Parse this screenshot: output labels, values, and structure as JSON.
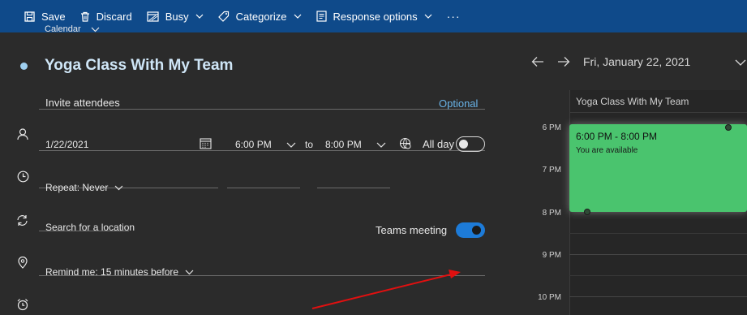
{
  "toolbar": {
    "save": "Save",
    "discard": "Discard",
    "busy": "Busy",
    "categorize": "Categorize",
    "response": "Response options",
    "more": "···"
  },
  "form": {
    "calendar_label": "Calendar",
    "title": "Yoga Class With My Team",
    "attendees_placeholder": "Invite attendees",
    "optional": "Optional",
    "date": "1/22/2021",
    "start_time": "6:00 PM",
    "to": "to",
    "end_time": "8:00 PM",
    "all_day": "All day",
    "all_day_on": false,
    "repeat": "Repeat: Never",
    "location_placeholder": "Search for a location",
    "teams_meeting": "Teams meeting",
    "teams_meeting_on": true,
    "remind": "Remind me: 15 minutes before"
  },
  "day_view": {
    "date": "Fri, January 22, 2021",
    "event_header": "Yoga Class With My Team",
    "hours": [
      "6 PM",
      "7 PM",
      "8 PM",
      "9 PM",
      "10 PM"
    ],
    "event": {
      "time": "6:00 PM - 8:00 PM",
      "availability": "You are available",
      "color": "#4ac46e"
    }
  },
  "colors": {
    "toolbar_bg": "#0f4a8a",
    "accent": "#1d7bd8",
    "annotation_arrow": "#e01010"
  }
}
